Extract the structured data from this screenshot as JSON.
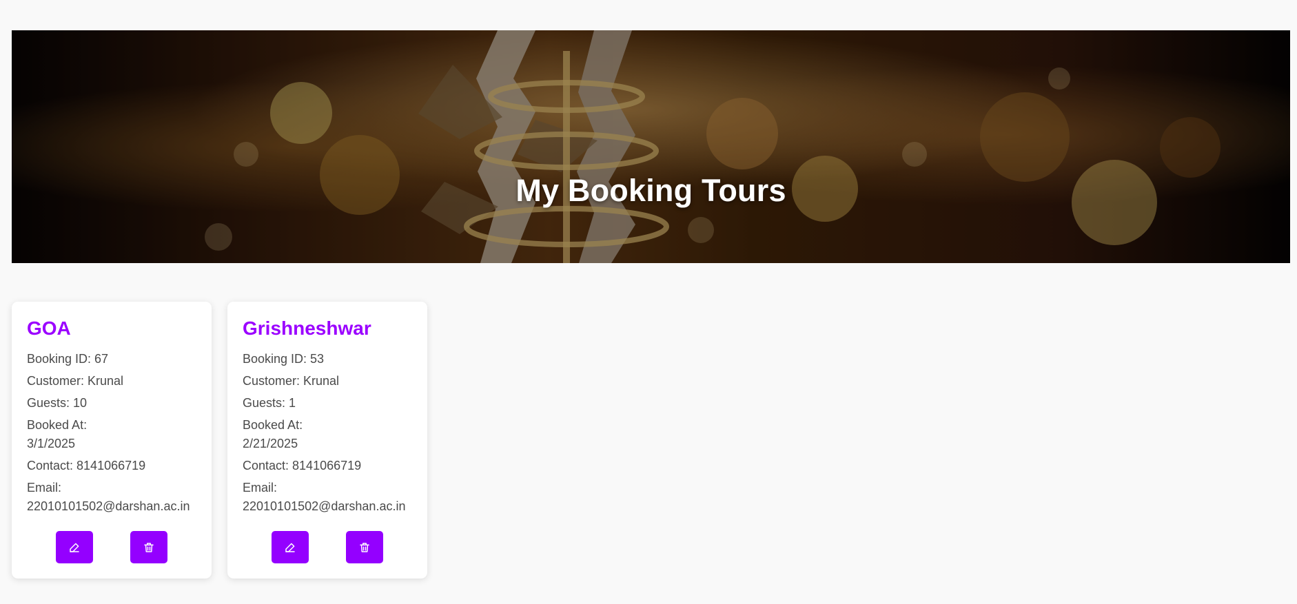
{
  "hero": {
    "title": "My Booking Tours"
  },
  "cards": [
    {
      "title": "GOA",
      "booking_id_label": "Booking ID: 67",
      "customer_label": "Customer: Krunal",
      "guests_label": "Guests: 10",
      "booked_at_label": "Booked At:",
      "booked_at_value": "3/1/2025",
      "contact_label": "Contact: 8141066719",
      "email_label": "Email:",
      "email_value": "22010101502@darshan.ac.in",
      "edit_icon": "edit-icon",
      "delete_icon": "trash-icon"
    },
    {
      "title": "Grishneshwar",
      "booking_id_label": "Booking ID: 53",
      "customer_label": "Customer: Krunal",
      "guests_label": "Guests: 1",
      "booked_at_label": "Booked At:",
      "booked_at_value": "2/21/2025",
      "contact_label": "Contact: 8141066719",
      "email_label": "Email:",
      "email_value": "22010101502@darshan.ac.in",
      "edit_icon": "edit-icon",
      "delete_icon": "trash-icon"
    }
  ],
  "colors": {
    "accent": "#9400ff",
    "title_purple": "#9b00ff",
    "text_gray": "#4a4a4a",
    "background": "#f9f9f9"
  }
}
